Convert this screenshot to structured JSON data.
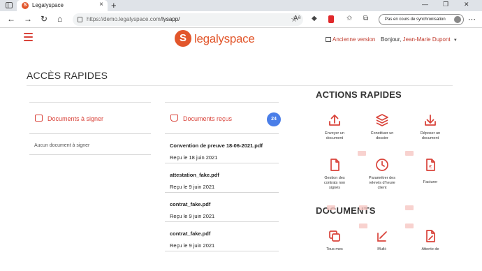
{
  "browser": {
    "tab_title": "Legalyspace",
    "url_host": "https://demo.legalyspace.com",
    "url_path": "/lysapp/",
    "sync_label": "Pas en cours de synchronisation"
  },
  "header": {
    "logo_text": "legalyspace",
    "old_version": "Ancienne version",
    "greeting": "Bonjour,",
    "user_name": "Jean-Marie Dupont"
  },
  "acces": {
    "title": "ACCÈS RAPIDES",
    "to_sign": {
      "title": "Documents à signer",
      "empty": "Aucun document à signer"
    },
    "received": {
      "title": "Documents reçus",
      "count": "24",
      "items": [
        {
          "name": "Convention de preuve 18-06-2021.pdf",
          "date": "Reçu le 18 juin 2021"
        },
        {
          "name": "attestation_fake.pdf",
          "date": "Reçu le 9 juin 2021"
        },
        {
          "name": "contrat_fake.pdf",
          "date": "Reçu le 9 juin 2021"
        },
        {
          "name": "contrat_fake.pdf",
          "date": "Reçu le 9 juin 2021"
        }
      ]
    }
  },
  "actions": {
    "title": "ACTIONS RAPIDES",
    "items": [
      {
        "l1": "Envoyer un",
        "l2": "document",
        "l3": "",
        "icon": "upload-icon"
      },
      {
        "l1": "Constituer un",
        "l2": "dossier",
        "l3": "",
        "icon": "layers-icon"
      },
      {
        "l1": "Déposer un",
        "l2": "document",
        "l3": "",
        "icon": "download-icon"
      },
      {
        "l1": "Gestion des",
        "l2": "contrats non",
        "l3": "signés",
        "icon": "file-icon"
      },
      {
        "l1": "Paramétrer des",
        "l2": "relevés d'heure",
        "l3": "client",
        "icon": "clock-icon"
      },
      {
        "l1": "Facturer",
        "l2": "",
        "l3": "",
        "icon": "euro-file-icon"
      }
    ]
  },
  "documents": {
    "title": "DOCUMENTS",
    "items": [
      {
        "l1": "Tous mes",
        "icon": "copy-icon"
      },
      {
        "l1": "Multi-",
        "icon": "multi-sign-icon"
      },
      {
        "l1": "Attente de",
        "icon": "pen-file-icon"
      }
    ]
  },
  "colors": {
    "brand": "#e2562b",
    "accent_red": "#d9433a",
    "badge_blue": "#4a7ee8"
  }
}
